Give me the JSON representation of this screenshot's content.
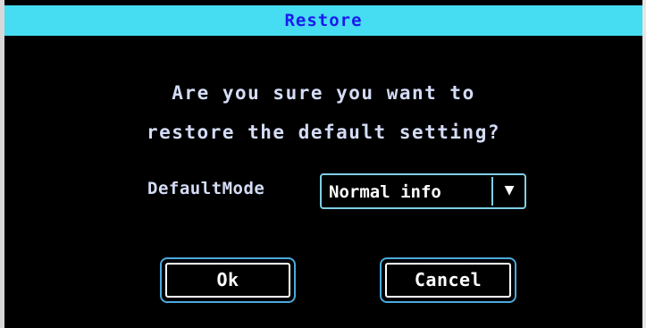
{
  "dialog": {
    "title": "Restore",
    "message_line1": "Are you sure you want to",
    "message_line2": "restore the default setting?",
    "default_mode": {
      "label": "DefaultMode",
      "selected": "Normal info"
    },
    "buttons": {
      "ok": "Ok",
      "cancel": "Cancel"
    }
  },
  "icons": {
    "dropdown": "triangle-down-icon"
  },
  "colors": {
    "title_bar": "#46dcf2",
    "title_text": "#1a1aee",
    "text": "#d4dcf6",
    "button_border": "#4aa9dd",
    "background": "#000000"
  }
}
